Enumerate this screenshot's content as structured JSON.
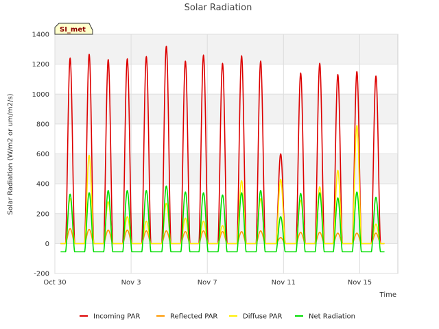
{
  "chart_data": {
    "type": "line",
    "title": "Solar Radiation",
    "xlabel": "Time",
    "ylabel": "Solar Radiation (W/m2 or um/m2/s)",
    "site_label": "SI_met",
    "xlim": [
      0,
      18
    ],
    "ylim": [
      -200,
      1400
    ],
    "y_ticks": [
      -200,
      0,
      200,
      400,
      600,
      800,
      1000,
      1200,
      1400
    ],
    "x_ticks": [
      {
        "day": 0,
        "label": "Oct 30"
      },
      {
        "day": 4,
        "label": "Nov 3"
      },
      {
        "day": 8,
        "label": "Nov 7"
      },
      {
        "day": 12,
        "label": "Nov 11"
      },
      {
        "day": 16,
        "label": "Nov 15"
      }
    ],
    "grid": true,
    "legend_position": "bottom",
    "day_noon": [
      0.8,
      1.8,
      2.8,
      3.8,
      4.8,
      5.85,
      6.85,
      7.8,
      8.8,
      9.8,
      10.8,
      11.85,
      12.9,
      13.9,
      14.85,
      15.85,
      16.85
    ],
    "series": [
      {
        "name": "Incoming PAR",
        "color": "#dd0000",
        "peaks": [
          1240,
          1265,
          1230,
          1235,
          1250,
          1320,
          1220,
          1260,
          1205,
          1255,
          1220,
          600,
          1140,
          1205,
          1130,
          1150,
          1120
        ]
      },
      {
        "name": "Reflected PAR",
        "color": "#ff9900",
        "peaks": [
          100,
          95,
          90,
          90,
          85,
          85,
          80,
          85,
          80,
          80,
          85,
          40,
          75,
          75,
          70,
          70,
          70
        ]
      },
      {
        "name": "Diffuse PAR",
        "color": "#ffee00",
        "peaks": [
          300,
          590,
          280,
          180,
          150,
          270,
          170,
          150,
          120,
          420,
          300,
          430,
          290,
          380,
          490,
          790,
          130
        ]
      },
      {
        "name": "Net Radiation",
        "color": "#00dd00",
        "peaks": [
          330,
          340,
          355,
          355,
          355,
          385,
          345,
          340,
          325,
          340,
          355,
          180,
          335,
          340,
          305,
          345,
          310
        ],
        "night_value": -55
      }
    ]
  }
}
